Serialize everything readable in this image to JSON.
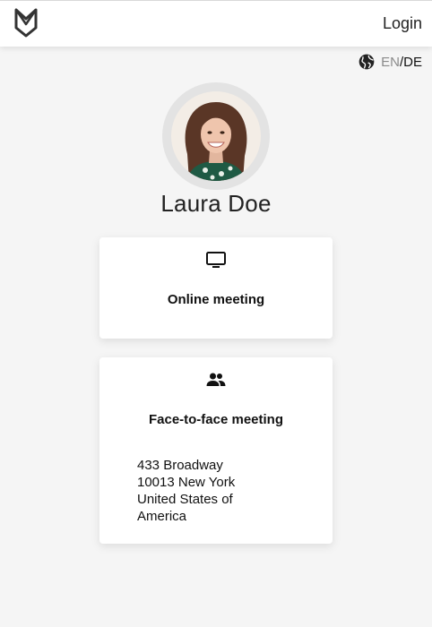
{
  "header": {
    "login_label": "Login",
    "logo_icon": "brand-shield-logo"
  },
  "language": {
    "icon": "globe-icon",
    "en": "EN",
    "separator": "/",
    "de": "DE",
    "active": "DE"
  },
  "profile": {
    "name": "Laura Doe"
  },
  "options": [
    {
      "icon": "monitor-icon",
      "title": "Online meeting"
    },
    {
      "icon": "people-icon",
      "title": "Face-to-face meeting",
      "address": [
        "433 Broadway",
        "10013 New York",
        "United States of",
        "America"
      ]
    }
  ],
  "colors": {
    "background": "#f5f5f5",
    "card": "#ffffff",
    "text": "#111111",
    "inactive_language": "#8a8a8a"
  }
}
